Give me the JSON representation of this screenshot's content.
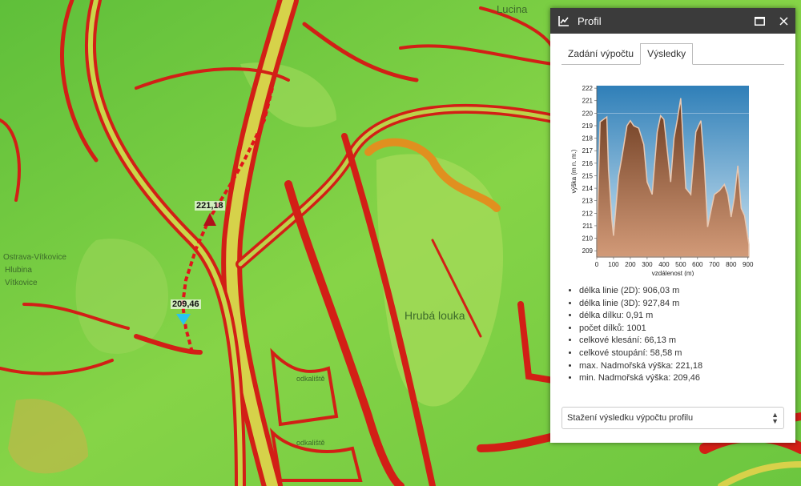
{
  "map": {
    "labels": [
      "Ostrava-Vítkovice",
      "Hrubá louka",
      "odkaliště",
      "odkaliště",
      "Lucina",
      "Vítkovice",
      "Hlubina"
    ],
    "markers": [
      {
        "label": "221,18",
        "type": "max"
      },
      {
        "label": "209,46",
        "type": "min"
      }
    ]
  },
  "panel": {
    "title": "Profil",
    "tabs": [
      {
        "label": "Zadání výpočtu",
        "active": false
      },
      {
        "label": "Výsledky",
        "active": true
      }
    ],
    "stats": [
      "délka linie (2D): 906,03 m",
      "délka linie (3D): 927,84 m",
      "délka dílku: 0,91 m",
      "počet dílků: 1001",
      "celkové klesání: 66,13 m",
      "celkové stoupání: 58,58 m",
      "max. Nadmořská výška: 221,18",
      "min. Nadmořská výška: 209,46"
    ],
    "download_label": "Stažení výsledku výpočtu profilu"
  },
  "chart_data": {
    "type": "area",
    "title": "",
    "xlabel": "vzdálenost (m)",
    "ylabel": "výška (m n. m.)",
    "xlim": [
      0,
      906
    ],
    "ylim": [
      208.5,
      222.2
    ],
    "xticks": [
      0,
      100,
      200,
      300,
      400,
      500,
      600,
      700,
      800,
      900
    ],
    "yticks": [
      209,
      210,
      211,
      212,
      213,
      214,
      215,
      216,
      217,
      218,
      219,
      220,
      221,
      222
    ],
    "series": [
      {
        "x": [
          0,
          20,
          60,
          70,
          90,
          100,
          130,
          150,
          180,
          200,
          220,
          250,
          280,
          300,
          330,
          360,
          380,
          400,
          420,
          440,
          460,
          480,
          500,
          530,
          560,
          590,
          620,
          640,
          660,
          700,
          730,
          760,
          780,
          800,
          820,
          840,
          860,
          880,
          906
        ],
        "y": [
          209.8,
          219.3,
          219.7,
          215.5,
          211.5,
          210.2,
          215.0,
          216.5,
          219.0,
          219.4,
          219.0,
          218.8,
          217.5,
          214.5,
          213.5,
          218.5,
          219.8,
          219.5,
          217.0,
          214.5,
          218.0,
          219.5,
          221.2,
          214.0,
          213.5,
          218.5,
          219.4,
          216.0,
          210.9,
          213.5,
          213.8,
          214.3,
          213.5,
          211.7,
          213.3,
          215.8,
          212.4,
          211.8,
          209.5
        ]
      }
    ],
    "colors": {
      "sky_top": "#2f7fb8",
      "sky_bottom": "#cfe5f2",
      "terrain_top": "#6b3a1f",
      "terrain_bottom": "#d29a78",
      "terrain_edge": "#e8c8b2"
    }
  }
}
